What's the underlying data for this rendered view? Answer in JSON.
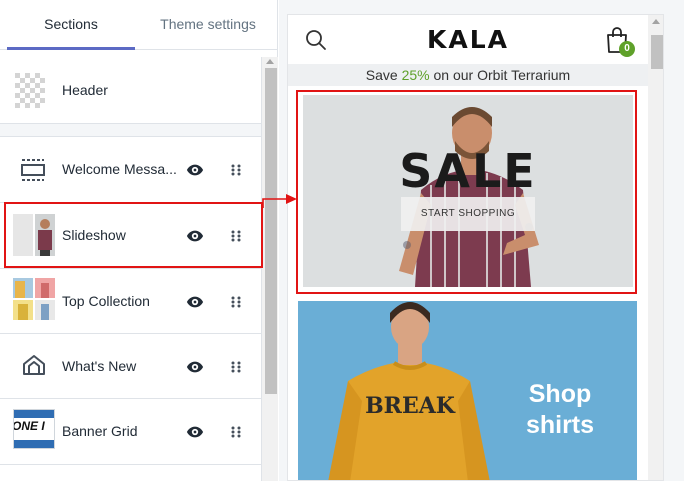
{
  "tabs": {
    "sections": "Sections",
    "theme_settings": "Theme settings"
  },
  "sections": [
    {
      "label": "Header"
    },
    {
      "label": "Welcome Messa..."
    },
    {
      "label": "Slideshow"
    },
    {
      "label": "Top Collection"
    },
    {
      "label": "What's New"
    },
    {
      "label": "Banner Grid"
    }
  ],
  "thumbs": {
    "banner_grid_text": "ONE I"
  },
  "preview": {
    "logo": "KALA",
    "cart_count": "0",
    "announcement": {
      "before": "Save ",
      "accent": "25%",
      "after": " on our Orbit Terrarium"
    },
    "slideshow": {
      "title": "SALE",
      "button": "START SHOPPING"
    },
    "banner": {
      "line1": "Shop",
      "line2": "shirts",
      "shirt_text": "BREAK"
    }
  },
  "colors": {
    "accent": "#5c6ac4",
    "highlight": "#e11414",
    "badge": "#5fa12a",
    "banner_bg": "#6aaed6"
  },
  "icons": [
    "eye-icon",
    "drag-handle-icon",
    "search-icon",
    "cart-icon",
    "arrow-right-icon"
  ]
}
